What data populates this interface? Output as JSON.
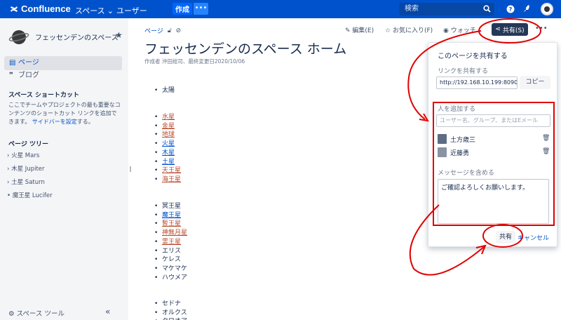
{
  "topbar": {
    "logo": "Confluence",
    "spaces_label": "スペース",
    "people_label": "ユーザー",
    "create_label": "作成",
    "create_more": "•••",
    "search_placeholder": "検索"
  },
  "sidebar": {
    "space_name": "フェッセンデンのスペース",
    "items": [
      {
        "label": "ページ",
        "icon": "page-icon"
      },
      {
        "label": "ブログ",
        "icon": "quote-icon"
      }
    ],
    "shortcuts_heading": "スペース ショートカット",
    "shortcuts_text": "ここでチームやプロジェクトの最も重要なコンテンツのショートカット リンクを追加できます。",
    "shortcuts_link": "サイドバーを設定",
    "shortcuts_tail": "する。",
    "tree_heading": "ページ ツリー",
    "tree": [
      {
        "label": "火星 Mars",
        "marker": "›"
      },
      {
        "label": "木星 Jupiter",
        "marker": "›"
      },
      {
        "label": "土星 Saturn",
        "marker": "›"
      },
      {
        "label": "魔王星 Lucifer",
        "marker": "•"
      }
    ],
    "space_tools": "スペース ツール"
  },
  "page": {
    "breadcrumb": "ページ",
    "actions": {
      "edit": "編集(E)",
      "favorite": "お気に入り(F)",
      "watch": "ウォッチ",
      "share": "共有(S)",
      "more": "•••"
    },
    "title": "フェッセンデンのスペース ホーム",
    "byline": "作成者 沖田総司、最終変更日2020/10/06",
    "lists": [
      [
        {
          "text": "太陽",
          "style": "plain"
        }
      ],
      [
        {
          "text": "水星",
          "style": "red"
        },
        {
          "text": "金星",
          "style": "red"
        },
        {
          "text": "地球",
          "style": "red"
        },
        {
          "text": "火星",
          "style": "blue"
        },
        {
          "text": "木星",
          "style": "blue"
        },
        {
          "text": "土星",
          "style": "blue"
        },
        {
          "text": "天王星",
          "style": "red"
        },
        {
          "text": "海王星",
          "style": "red"
        }
      ],
      [
        {
          "text": "冥王星",
          "style": "plain"
        },
        {
          "text": "魔王星",
          "style": "blue"
        },
        {
          "text": "暫王星",
          "style": "red"
        },
        {
          "text": "神無月星",
          "style": "red"
        },
        {
          "text": "霊王星",
          "style": "red"
        },
        {
          "text": "エリス",
          "style": "plain"
        },
        {
          "text": "ケレス",
          "style": "plain"
        },
        {
          "text": "マケマケ",
          "style": "plain"
        },
        {
          "text": "ハウメア",
          "style": "plain"
        }
      ],
      [
        {
          "text": "セドナ",
          "style": "plain"
        },
        {
          "text": "オルクス",
          "style": "plain"
        },
        {
          "text": "クワオア",
          "style": "plain"
        }
      ]
    ]
  },
  "share_dialog": {
    "title": "このページを共有する",
    "link_label": "リンクを共有する",
    "link_value": "http://192.168.10.199:8090",
    "copy_label": "コピー",
    "add_people_label": "人を追加する",
    "add_people_placeholder": "ユーザー名、グループ、またはEメール",
    "people": [
      {
        "name": "土方歳三"
      },
      {
        "name": "近藤勇"
      }
    ],
    "message_label": "メッセージを含める",
    "message_value": "ご確認よろしくお願いします。",
    "share_label": "共有",
    "cancel_label": "キャンセル"
  },
  "colors": {
    "topbar": "#0052cc",
    "sidebar": "#f4f5f7",
    "annotation": "#e00000",
    "link_red": "#b94a2c",
    "link_blue": "#0052cc"
  }
}
